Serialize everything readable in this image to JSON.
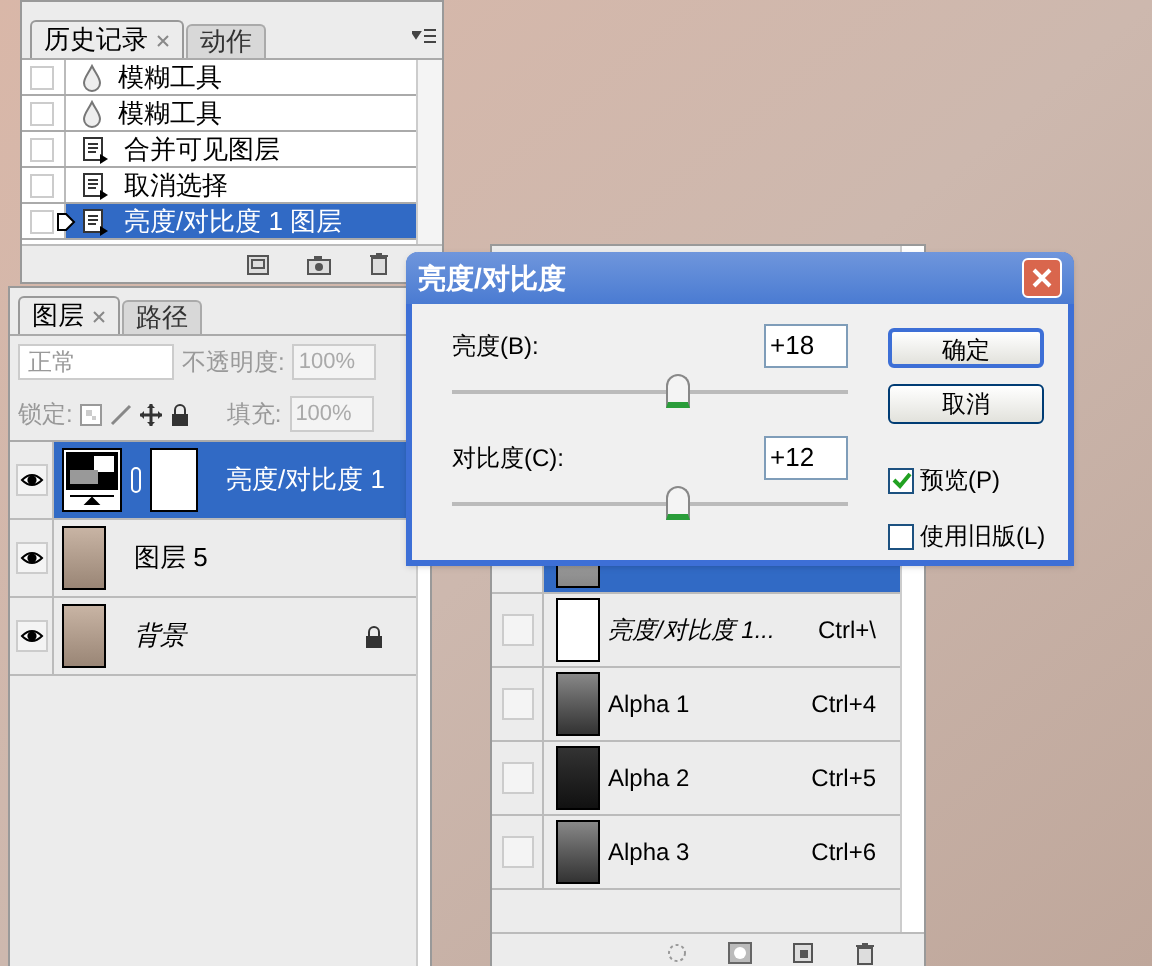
{
  "history": {
    "tabs": [
      {
        "label": "历史记录",
        "selected": true,
        "closable": true
      },
      {
        "label": "动作",
        "selected": false,
        "closable": false
      }
    ],
    "items": [
      {
        "label": "模糊工具",
        "kind": "blur",
        "selected": false
      },
      {
        "label": "模糊工具",
        "kind": "blur",
        "selected": false
      },
      {
        "label": "合并可见图层",
        "kind": "action",
        "selected": false
      },
      {
        "label": "取消选择",
        "kind": "action",
        "selected": false
      },
      {
        "label": "亮度/对比度 1 图层",
        "kind": "action",
        "selected": true
      }
    ]
  },
  "layers": {
    "tabs": [
      {
        "label": "图层",
        "selected": true,
        "closable": true
      },
      {
        "label": "路径",
        "selected": false,
        "closable": false
      }
    ],
    "blend_mode": {
      "value": "正常",
      "disabled": true
    },
    "opacity": {
      "label": "不透明度:",
      "value": "100%",
      "disabled": true
    },
    "lock": {
      "label": "锁定:"
    },
    "fill": {
      "label": "填充:",
      "value": "100%",
      "disabled": true
    },
    "items": [
      {
        "name": "亮度/对比度 1",
        "kind": "adjustment",
        "visible": true,
        "locked": false,
        "selected": true
      },
      {
        "name": "图层 5",
        "kind": "pixel",
        "visible": true,
        "locked": false,
        "selected": false
      },
      {
        "name": "背景",
        "kind": "background",
        "visible": true,
        "locked": true,
        "selected": false
      }
    ]
  },
  "channels": {
    "items": [
      {
        "kind": "composite",
        "selected": true
      },
      {
        "name": "亮度/对比度 1...",
        "shortcut": "Ctrl+\\",
        "kind": "mask",
        "visible": false,
        "selected": false
      },
      {
        "name": "Alpha 1",
        "shortcut": "Ctrl+4",
        "kind": "alpha",
        "visible": false,
        "selected": false
      },
      {
        "name": "Alpha 2",
        "shortcut": "Ctrl+5",
        "kind": "alpha",
        "visible": false,
        "selected": false
      },
      {
        "name": "Alpha 3",
        "shortcut": "Ctrl+6",
        "kind": "alpha",
        "visible": false,
        "selected": false
      }
    ]
  },
  "dialog": {
    "title": "亮度/对比度",
    "sliders": [
      {
        "label": "亮度(B):",
        "value": "+18",
        "level": 0.57
      },
      {
        "label": "对比度(C):",
        "value": "+12",
        "level": 0.57
      }
    ],
    "buttons": [
      "确定",
      "取消"
    ],
    "checkboxes": [
      {
        "label": "预览(P)",
        "checked": true
      },
      {
        "label": "使用旧版(L)",
        "checked": false
      }
    ]
  }
}
